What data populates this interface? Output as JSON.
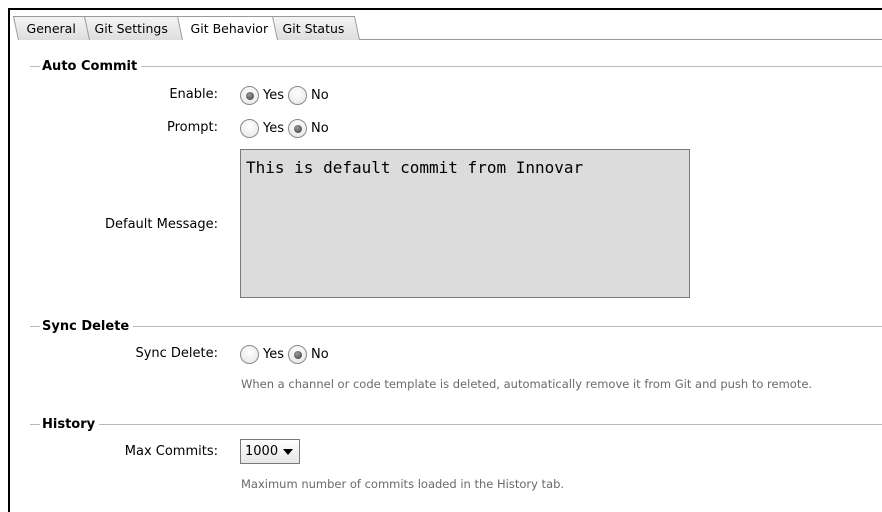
{
  "tabs": {
    "general": "General",
    "git_settings": "Git Settings",
    "git_behavior": "Git Behavior",
    "git_status": "Git Status"
  },
  "auto_commit": {
    "title": "Auto Commit",
    "enable_label": "Enable:",
    "enable_yes": "Yes",
    "enable_no": "No",
    "enable_value": "Yes",
    "prompt_label": "Prompt:",
    "prompt_yes": "Yes",
    "prompt_no": "No",
    "prompt_value": "No",
    "default_message_label": "Default Message:",
    "default_message_value": "This is default commit from Innovar"
  },
  "sync_delete": {
    "title": "Sync Delete",
    "label": "Sync Delete:",
    "yes": "Yes",
    "no": "No",
    "value": "No",
    "hint": "When a channel or code template is deleted, automatically remove it from Git and push to remote."
  },
  "history": {
    "title": "History",
    "max_commits_label": "Max Commits:",
    "max_commits_value": "1000",
    "hint": "Maximum number of commits loaded in the History tab."
  }
}
